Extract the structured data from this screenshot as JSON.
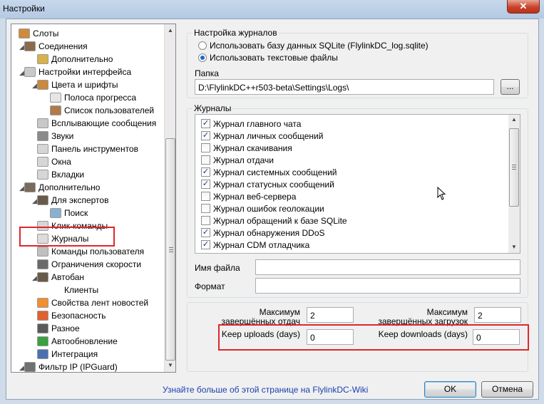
{
  "window": {
    "title": "Настройки",
    "close_glyph": "✕"
  },
  "tree": {
    "items": [
      {
        "label": "Слоты",
        "icon": "slots-icon",
        "color": "#d08a3a"
      },
      {
        "label": "Соединения",
        "icon": "connection-user-icon",
        "color": "#8a6a4a"
      },
      {
        "label": "Дополнительно",
        "icon": "key-icon",
        "color": "#d7b24a"
      },
      {
        "label": "Настройки интерфейса",
        "icon": "window-icon",
        "color": "#c9c9c9"
      },
      {
        "label": "Цвета и шрифты",
        "icon": "palette-icon",
        "color": "#c9893e"
      },
      {
        "label": "Полоса прогресса",
        "icon": "progress-icon",
        "color": "#e6e6e6"
      },
      {
        "label": "Список пользователей",
        "icon": "users-icon",
        "color": "#b07a4a"
      },
      {
        "label": "Всплывающие сообщения",
        "icon": "popup-icon",
        "color": "#c8c8c8"
      },
      {
        "label": "Звуки",
        "icon": "speaker-icon",
        "color": "#8a8a8a"
      },
      {
        "label": "Панель инструментов",
        "icon": "toolbar-icon",
        "color": "#d6d6d6"
      },
      {
        "label": "Окна",
        "icon": "windows-icon",
        "color": "#d6d6d6"
      },
      {
        "label": "Вкладки",
        "icon": "tabs-icon",
        "color": "#d6d6d6"
      },
      {
        "label": "Дополнительно",
        "icon": "tools-icon",
        "color": "#7a6a5a"
      },
      {
        "label": "Для экспертов",
        "icon": "expert-user-icon",
        "color": "#6a5a4a"
      },
      {
        "label": "Поиск",
        "icon": "search-icon",
        "color": "#8ab0d0"
      },
      {
        "label": "Клик-команды",
        "icon": "click-icon",
        "color": "#d6d6d6"
      },
      {
        "label": "Журналы",
        "icon": "log-file-icon",
        "color": "#dcdcdc"
      },
      {
        "label": "Команды пользователя",
        "icon": "commands-icon",
        "color": "#c0c0c0"
      },
      {
        "label": "Ограничения скорости",
        "icon": "speedometer-icon",
        "color": "#6a6a6a"
      },
      {
        "label": "Автобан",
        "icon": "autoban-icon",
        "color": "#6a5a4a"
      },
      {
        "label": "Клиенты",
        "icon": "",
        "color": ""
      },
      {
        "label": "Свойства лент новостей",
        "icon": "rss-icon",
        "color": "#f09030"
      },
      {
        "label": "Безопасность",
        "icon": "security-icon",
        "color": "#e06030"
      },
      {
        "label": "Разное",
        "icon": "misc-icon",
        "color": "#5a5a5a"
      },
      {
        "label": "Автообновление",
        "icon": "update-icon",
        "color": "#3aa040"
      },
      {
        "label": "Интеграция",
        "icon": "integration-icon",
        "color": "#4a70b0"
      },
      {
        "label": "Фильтр IP (IPGuard)",
        "icon": "ipguard-icon",
        "color": "#707070"
      }
    ]
  },
  "logsettings": {
    "group_label": "Настройка журналов",
    "option_sqlite": "Использовать базу данных SQLite (FlylinkDC_log.sqlite)",
    "option_text": "Использовать текстовые файлы",
    "folder_label": "Папка",
    "folder_value": "D:\\FlylinkDC++r503-beta\\Settings\\Logs\\",
    "browse_label": "..."
  },
  "logs": {
    "group_label": "Журналы",
    "items": [
      {
        "label": "Журнал главного чата",
        "checked": true
      },
      {
        "label": "Журнал личных сообщений",
        "checked": true
      },
      {
        "label": "Журнал скачивания",
        "checked": false
      },
      {
        "label": "Журнал отдачи",
        "checked": false
      },
      {
        "label": "Журнал системных сообщений",
        "checked": true
      },
      {
        "label": "Журнал статусных сообщений",
        "checked": true
      },
      {
        "label": "Журнал веб-сервера",
        "checked": false
      },
      {
        "label": "Журнал ошибок геолокации",
        "checked": false
      },
      {
        "label": "Журнал обращений к базе SQLite",
        "checked": false
      },
      {
        "label": "Журнал обнаружения DDoS",
        "checked": true
      },
      {
        "label": "Журнал CDM отладчика",
        "checked": true
      }
    ],
    "check_glyph": "✓"
  },
  "fields": {
    "filename_label": "Имя файла",
    "format_label": "Формат",
    "max_uploads_label": "Максимум завершённых отдач",
    "max_uploads_value": "2",
    "max_downloads_label": "Максимум завершённых загрузок",
    "max_downloads_value": "2",
    "keep_uploads_label": "Keep uploads (days)",
    "keep_uploads_value": "0",
    "keep_downloads_label": "Keep downloads (days)",
    "keep_downloads_value": "0"
  },
  "footer": {
    "link": "Узнайте больше об этой странице на FlylinkDC-Wiki",
    "ok": "OK",
    "cancel": "Отмена"
  }
}
